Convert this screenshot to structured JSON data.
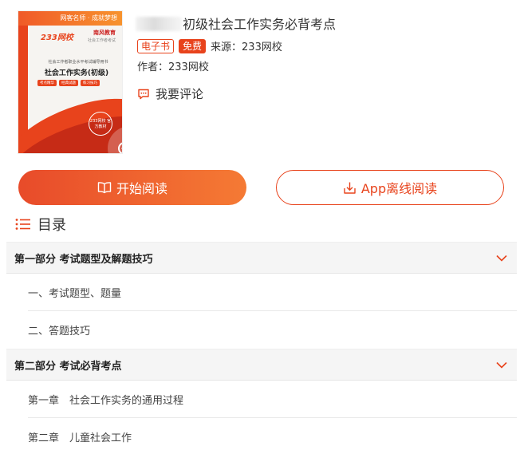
{
  "book": {
    "title_suffix": "初级社会工作实务必背考点",
    "tag_ebook": "电子书",
    "tag_free": "免费",
    "source": "来源：233网校",
    "author": "作者：233网校",
    "comment": "我要评论",
    "cover": {
      "ribbon_text": "网客名师 · 成就梦想",
      "brand": "233网校",
      "publisher": "南风教育",
      "publisher_sub": "社会工作者考试",
      "subline": "社会工作者职业水平考试辅导用书",
      "title": "社会工作实务(初级)",
      "pills": [
        "考点精华",
        "经典试题",
        "练习技巧"
      ],
      "seal": "233网校 官方教材"
    }
  },
  "actions": {
    "read": "开始阅读",
    "app_read": "App离线阅读"
  },
  "toc": {
    "title": "目录",
    "sections": [
      {
        "title": "第一部分 考试题型及解题技巧",
        "items": [
          "一、考试题型、题量",
          "二、答题技巧"
        ]
      },
      {
        "title": "第二部分 考试必背考点",
        "items": [
          "第一章　社会工作实务的通用过程",
          "第二章　儿童社会工作"
        ]
      }
    ]
  },
  "colors": {
    "accent": "#e8431c",
    "button_gradient_start": "#e84b2a",
    "button_gradient_end": "#f57a34",
    "section_bg": "#f5f5f5"
  }
}
